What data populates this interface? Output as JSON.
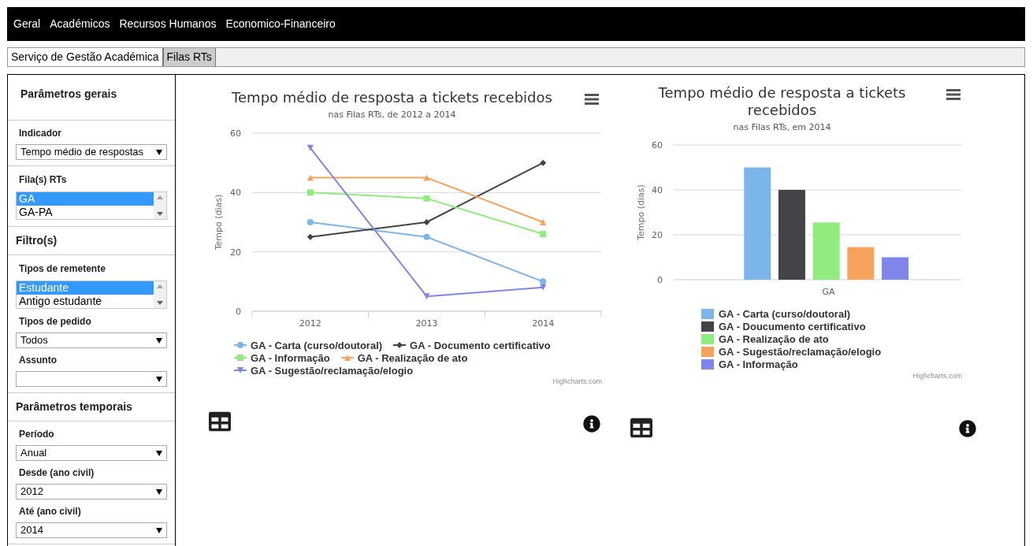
{
  "nav": {
    "items": [
      "Geral",
      "Académicos",
      "Recursos Humanos",
      "Economico-Financeiro"
    ]
  },
  "tabs": [
    {
      "label": "Serviço de Gestão Académica",
      "selected": false
    },
    {
      "label": "Filas RTs",
      "selected": true
    }
  ],
  "sidebar": {
    "sections": [
      {
        "heading": "Parâmetros gerais"
      },
      {
        "fields": [
          {
            "kind": "select",
            "label": "Indicador",
            "value": "Tempo médio de respostas"
          }
        ]
      },
      {
        "fields": [
          {
            "kind": "listbox",
            "label": "Fila(s) RTs",
            "options": [
              {
                "text": "GA",
                "selected": true
              },
              {
                "text": "GA-PA",
                "selected": false
              }
            ]
          }
        ]
      },
      {
        "heading": "Filtro(s)"
      },
      {
        "fields": [
          {
            "kind": "listbox",
            "label": "Tipos de remetente",
            "options": [
              {
                "text": "Estudante",
                "selected": true
              },
              {
                "text": "Antigo estudante",
                "selected": false
              }
            ]
          },
          {
            "kind": "select",
            "label": "Tipos de pedido",
            "value": "Todos"
          },
          {
            "kind": "select",
            "label": "Assunto"
          }
        ]
      },
      {
        "heading": "Parâmetros temporais"
      },
      {
        "fields": [
          {
            "kind": "select",
            "label": "Período",
            "value": "Anual"
          },
          {
            "kind": "select",
            "label": "Desde (ano civil)",
            "value": "2012"
          },
          {
            "kind": "select",
            "label": "Até (ano civil)",
            "value": "2014"
          }
        ]
      }
    ]
  },
  "charts": [
    {
      "subtitle": "nas Filas RTs, de 2012 a 2014",
      "credits": "Highcharts.com",
      "chart_data": {
        "type": "line",
        "legend": "bottom",
        "title": "Tempo médio de resposta a tickets recebidos",
        "ylabel": "Tempo (dias)",
        "categories": [
          "2012",
          "2013",
          "2014"
        ],
        "ylim": [
          0,
          60
        ],
        "yticks": [
          0,
          20,
          40,
          60
        ],
        "series": [
          {
            "name": "GA - Carta (curso/doutoral)",
            "color": "#7cb5ec",
            "marker": "circle",
            "values": [
              30,
              25,
              10
            ]
          },
          {
            "name": "GA - Documento certificativo",
            "color": "#434348",
            "marker": "diamond",
            "values": [
              25,
              30,
              50
            ]
          },
          {
            "name": "GA - Informação",
            "color": "#90ed7d",
            "marker": "square",
            "values": [
              40,
              38,
              26
            ]
          },
          {
            "name": "GA - Realização de ato",
            "color": "#f7a35c",
            "marker": "triangle",
            "values": [
              45,
              45,
              30
            ]
          },
          {
            "name": "GA - Sugestão/reclamação/elogio",
            "color": "#8085e9",
            "marker": "triangle-down",
            "values": [
              55,
              5,
              8
            ]
          }
        ]
      }
    },
    {
      "subtitle": "nas Filas RTs, em 2014",
      "credits": "Highcharts.com",
      "chart_data": {
        "type": "bar",
        "legend": "bottom",
        "title": "Tempo médio de resposta a tickets recebidos",
        "ylabel": "Tempo (dias)",
        "categories": [
          "GA"
        ],
        "ylim": [
          0,
          60
        ],
        "yticks": [
          0,
          20,
          40,
          60
        ],
        "series": [
          {
            "name": "GA - Carta (curso/doutoral)",
            "color": "#7cb5ec",
            "values": [
              50
            ]
          },
          {
            "name": "GA - Doucumento certificativo",
            "color": "#434348",
            "values": [
              40
            ]
          },
          {
            "name": "GA - Realização de ato",
            "color": "#90ed7d",
            "values": [
              25.5
            ]
          },
          {
            "name": "GA - Sugestão/reclamação/elogio",
            "color": "#f7a35c",
            "values": [
              14.5
            ]
          },
          {
            "name": "GA - Informação",
            "color": "#8085e9",
            "values": [
              10
            ]
          }
        ]
      }
    }
  ]
}
